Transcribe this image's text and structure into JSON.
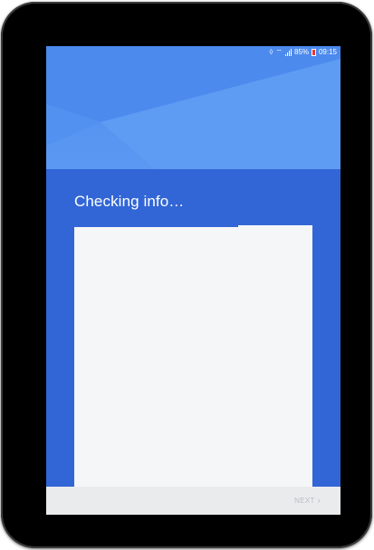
{
  "status_bar": {
    "battery_text": "85%",
    "time": "09:15",
    "icons": [
      "nfc-icon",
      "wifi-icon",
      "signal-icon",
      "battery-icon"
    ]
  },
  "setup": {
    "title": "Checking info…",
    "progress_fraction": 0.69
  },
  "footer": {
    "next_label": "NEXT"
  },
  "colors": {
    "header_blue": "#5b98f2",
    "primary_blue": "#3266d6",
    "card": "#f5f6f7",
    "footer": "#e9ebed",
    "next_disabled": "#b9bdc2",
    "battery_low": "#e53935"
  }
}
